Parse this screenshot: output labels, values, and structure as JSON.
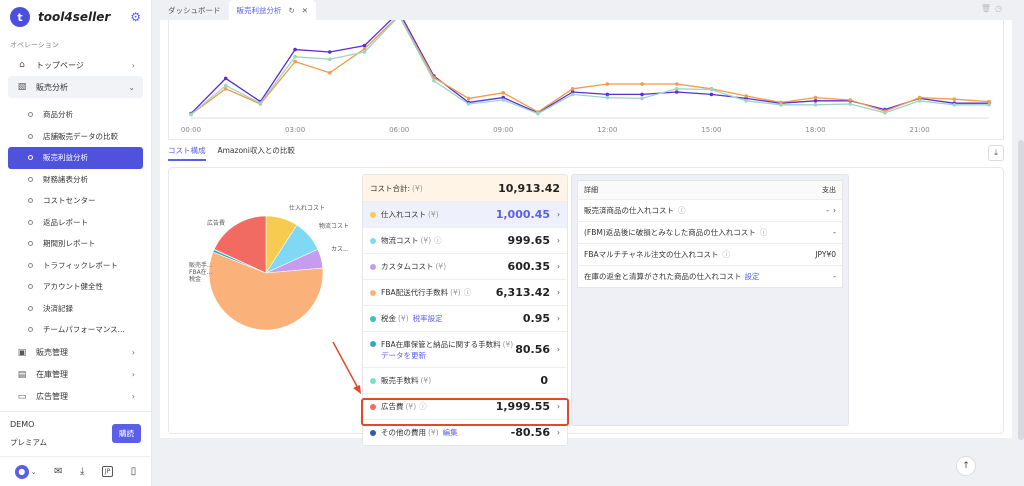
{
  "app": {
    "name": "tool4seller",
    "logo_letter": "t"
  },
  "sidebar": {
    "section_label": "オペレーション",
    "top_items": [
      {
        "label": "トップページ"
      },
      {
        "label": "販売分析"
      }
    ],
    "sub_items": [
      {
        "label": "商品分析"
      },
      {
        "label": "店舗販売データの比較"
      },
      {
        "label": "販売利益分析"
      },
      {
        "label": "財務諸表分析"
      },
      {
        "label": "コストセンター"
      },
      {
        "label": "返品レポート"
      },
      {
        "label": "期間別レポート"
      },
      {
        "label": "トラフィックレポート"
      },
      {
        "label": "アカウント健全性"
      },
      {
        "label": "決済記録"
      },
      {
        "label": "チームパフォーマンス..."
      }
    ],
    "bottom_items": [
      {
        "label": "販売管理"
      },
      {
        "label": "在庫管理"
      },
      {
        "label": "広告管理"
      }
    ],
    "account": {
      "name": "DEMO",
      "plan": "プレミアム",
      "buy_label": "購読"
    },
    "footer_icons": [
      "user-icon",
      "mail-icon",
      "download-icon",
      "jp-icon",
      "phone-icon"
    ],
    "jp_label": "JP"
  },
  "tabs": [
    {
      "label": "ダッシュボード"
    },
    {
      "label": "販売利益分析"
    }
  ],
  "chart_data": {
    "type": "line",
    "x_ticks": [
      "00:00",
      "03:00",
      "06:00",
      "09:00",
      "12:00",
      "15:00",
      "18:00",
      "21:00"
    ],
    "x": [
      "00:00",
      "01:00",
      "02:00",
      "03:00",
      "04:00",
      "05:00",
      "06:00",
      "07:00",
      "08:00",
      "09:00",
      "10:00",
      "11:00",
      "12:00",
      "13:00",
      "14:00",
      "15:00",
      "16:00",
      "17:00",
      "18:00",
      "19:00",
      "20:00",
      "21:00",
      "22:00",
      "23:00"
    ],
    "series": [
      {
        "color": "#5b2ed6",
        "values": [
          3,
          47,
          18,
          83,
          80,
          88,
          130,
          50,
          17,
          23,
          4,
          30,
          27,
          27,
          30,
          27,
          22,
          16,
          19,
          19,
          8,
          22,
          16,
          16
        ]
      },
      {
        "color": "#f29b4b",
        "values": [
          2,
          34,
          15,
          68,
          54,
          84,
          126,
          48,
          22,
          29,
          5,
          34,
          40,
          40,
          40,
          34,
          25,
          17,
          23,
          20,
          6,
          23,
          21,
          18
        ]
      },
      {
        "color": "#9ad6c8",
        "values": [
          2,
          38,
          16,
          74,
          71,
          80,
          125,
          44,
          15,
          20,
          3,
          27,
          23,
          22,
          34,
          33,
          19,
          14,
          14,
          15,
          4,
          19,
          14,
          14
        ]
      }
    ],
    "ylim": [
      0,
      120
    ]
  },
  "subtabs": [
    {
      "label": "コスト構成"
    },
    {
      "label": "Amazoni収入との比較"
    }
  ],
  "pie": {
    "labels": [
      "仕入れコスト",
      "物流コスト",
      "カス...",
      "FBA配送代行手数料",
      "税金",
      "FBA在...",
      "販売手...",
      "広告費"
    ],
    "values": [
      1000.45,
      999.65,
      600.35,
      6313.42,
      0.95,
      80.56,
      10,
      1999.55
    ],
    "colors": [
      "#f6cb4f",
      "#7fd9f5",
      "#c59cf0",
      "#fbb27a",
      "#3ec0c7",
      "#2fa8c4",
      "#72e3c3",
      "#f26b63"
    ]
  },
  "cost": {
    "total_label": "コスト合計:",
    "yen": "(¥)",
    "total": "10,913.42",
    "rows": [
      {
        "label": "仕入れコスト",
        "amount": "1,000.45",
        "color": "#f6cb4f"
      },
      {
        "label": "物流コスト",
        "amount": "999.65",
        "color": "#7fd9f5"
      },
      {
        "label": "カスタムコスト",
        "amount": "600.35",
        "color": "#c59cf0"
      },
      {
        "label": "FBA配送代行手数料",
        "amount": "6,313.42",
        "color": "#fbb27a"
      },
      {
        "label": "税金",
        "link": "税率設定",
        "amount": "0.95",
        "color": "#3ec0c7"
      },
      {
        "label": "FBA在庫保管と納品に関する手数料",
        "link": "データを更新",
        "amount": "80.56",
        "color": "#2fa8c4"
      },
      {
        "label": "販売手数料",
        "amount": "0",
        "color": "#72e3c3"
      },
      {
        "label": "広告費",
        "amount": "1,999.55",
        "color": "#f26b63"
      },
      {
        "label": "その他の費用",
        "link": "編集",
        "amount": "-80.56",
        "color": "#3a5a9c"
      }
    ]
  },
  "details": {
    "header_left": "詳細",
    "header_right": "支出",
    "rows": [
      {
        "label": "販売済商品の仕入れコスト",
        "value": "-"
      },
      {
        "label": "(FBM)返品後に破損とみなした商品の仕入れコスト",
        "value": "-"
      },
      {
        "label": "FBAマルチチャネル注文の仕入れコスト",
        "value": "JPY¥0"
      },
      {
        "label": "在庫の返金と清算がされた商品の仕入れコスト",
        "link": "設定",
        "value": "-"
      }
    ]
  }
}
